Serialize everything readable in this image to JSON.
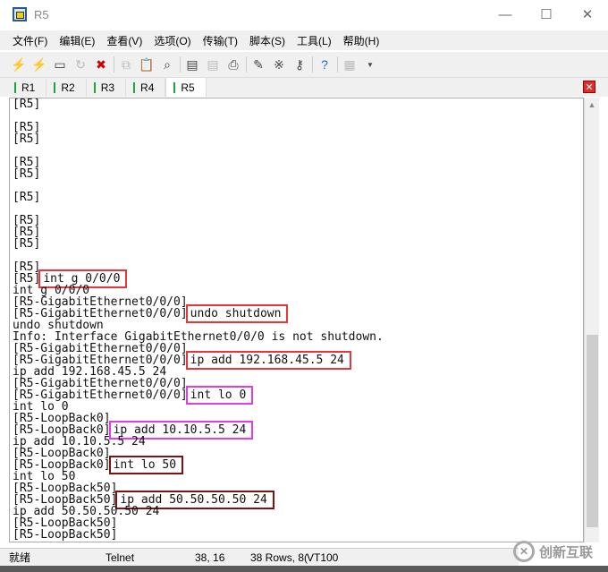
{
  "window": {
    "title": "R5",
    "minimize": "—",
    "maximize": "☐",
    "close": "✕"
  },
  "menu": [
    "文件(F)",
    "编辑(E)",
    "查看(V)",
    "选项(O)",
    "传输(T)",
    "脚本(S)",
    "工具(L)",
    "帮助(H)"
  ],
  "tabs": [
    "R1",
    "R2",
    "R3",
    "R4",
    "R5"
  ],
  "active_tab": "R5",
  "terminal": {
    "lines": [
      [
        "[R5]"
      ],
      [
        ""
      ],
      [
        "[R5]"
      ],
      [
        "[R5]"
      ],
      [
        ""
      ],
      [
        "[R5]"
      ],
      [
        "[R5]"
      ],
      [
        ""
      ],
      [
        "[R5]"
      ],
      [
        ""
      ],
      [
        "[R5]"
      ],
      [
        "[R5]"
      ],
      [
        "[R5]"
      ],
      [
        ""
      ],
      [
        "[R5]"
      ],
      [
        "[R5]",
        "int g 0/0/0",
        "red"
      ],
      [
        "int g 0/0/0"
      ],
      [
        "[R5-GigabitEthernet0/0/0]"
      ],
      [
        "[R5-GigabitEthernet0/0/0]",
        "undo shutdown",
        "red"
      ],
      [
        "undo shutdown"
      ],
      [
        "Info: Interface GigabitEthernet0/0/0 is not shutdown."
      ],
      [
        "[R5-GigabitEthernet0/0/0]"
      ],
      [
        "[R5-GigabitEthernet0/0/0]",
        "ip add 192.168.45.5 24",
        "red"
      ],
      [
        "ip add 192.168.45.5 24"
      ],
      [
        "[R5-GigabitEthernet0/0/0]"
      ],
      [
        "[R5-GigabitEthernet0/0/0]",
        "int lo 0",
        "mag"
      ],
      [
        "int lo 0"
      ],
      [
        "[R5-LoopBack0]"
      ],
      [
        "[R5-LoopBack0]",
        "ip add 10.10.5.5 24",
        "mag"
      ],
      [
        "ip add 10.10.5.5 24"
      ],
      [
        "[R5-LoopBack0]"
      ],
      [
        "[R5-LoopBack0]",
        "int lo 50",
        "dark"
      ],
      [
        "int lo 50"
      ],
      [
        "[R5-LoopBack50]"
      ],
      [
        "[R5-LoopBack50]",
        "ip add 50.50.50.50 24",
        "dark"
      ],
      [
        "ip add 50.50.50.50 24"
      ],
      [
        "[R5-LoopBack50]"
      ],
      [
        "[R5-LoopBack50]"
      ]
    ]
  },
  "status": {
    "ready": "就绪",
    "protocol": "Telnet",
    "cursor": "38, 16",
    "size": "38 Rows, 8(",
    "emulation": "VT100"
  },
  "watermark": "创新互联"
}
